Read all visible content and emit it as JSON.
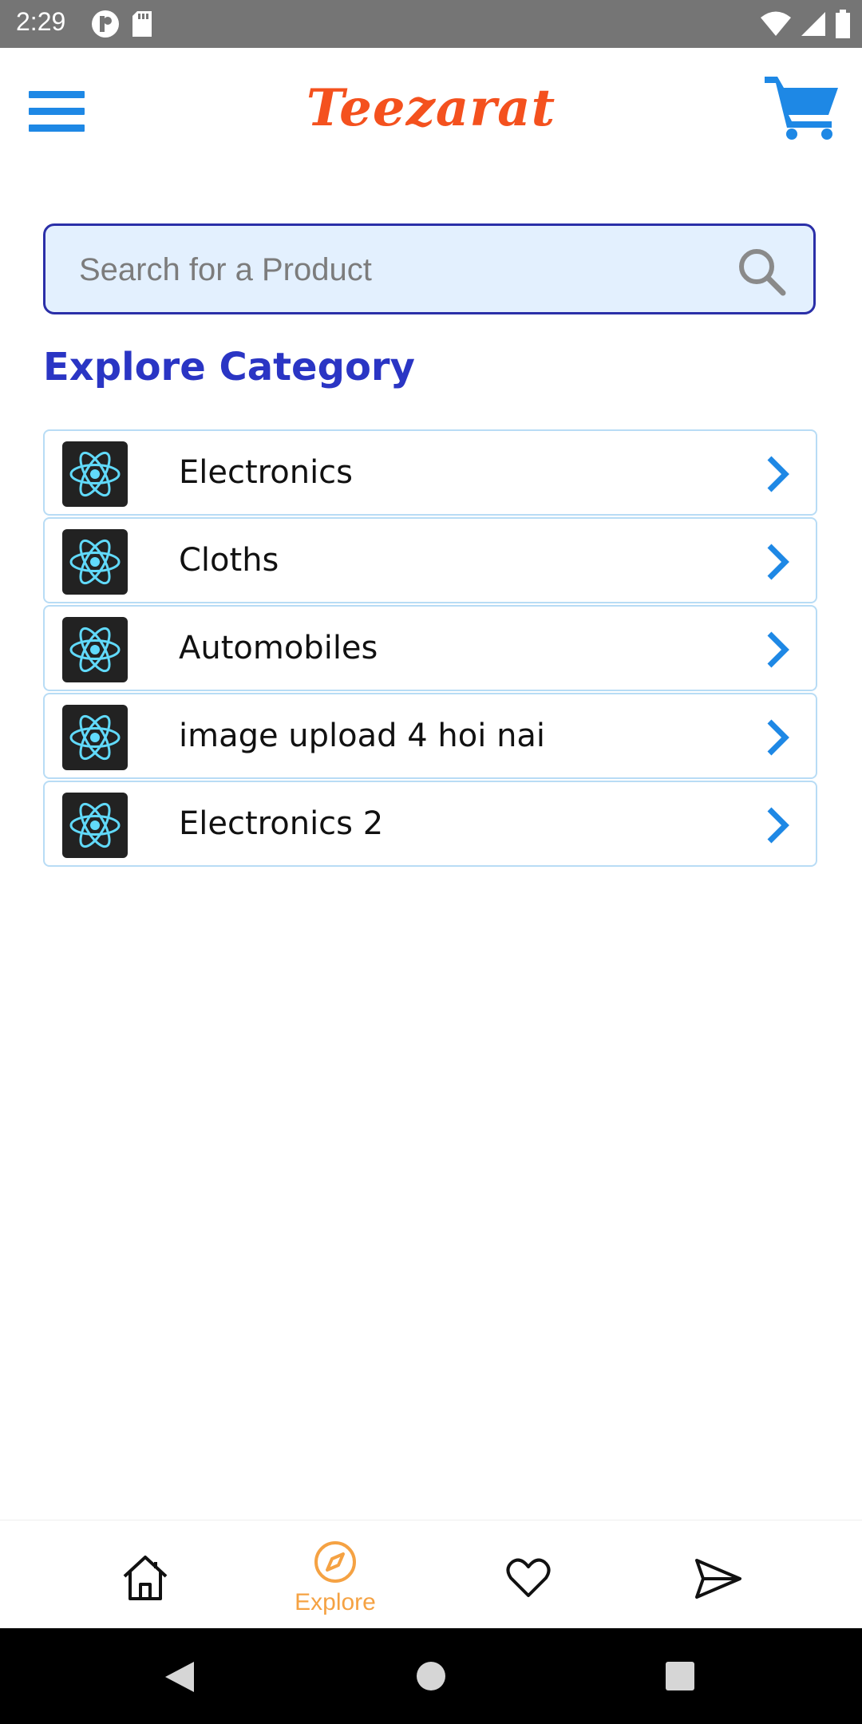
{
  "status_bar": {
    "time": "2:29",
    "icons": [
      "profile-notification-icon",
      "sd-card-icon",
      "wifi-icon",
      "signal-icon",
      "battery-icon"
    ]
  },
  "header": {
    "title": "Teezarat",
    "menu_icon": "hamburger-menu-icon",
    "cart_icon": "cart-icon",
    "title_color": "#f4511e",
    "accent_color": "#1e88e5"
  },
  "search": {
    "placeholder": "Search for a Product",
    "value": "",
    "icon": "search-icon"
  },
  "section": {
    "title": "Explore Category"
  },
  "categories": [
    {
      "label": "Electronics",
      "icon": "react-logo-icon"
    },
    {
      "label": "Cloths",
      "icon": "react-logo-icon"
    },
    {
      "label": "Automobiles",
      "icon": "react-logo-icon"
    },
    {
      "label": "image upload 4 hoi nai",
      "icon": "react-logo-icon"
    },
    {
      "label": "Electronics 2",
      "icon": "react-logo-icon"
    }
  ],
  "bottom_nav": {
    "items": [
      {
        "icon": "home-icon",
        "label": ""
      },
      {
        "icon": "compass-icon",
        "label": "Explore",
        "active": true
      },
      {
        "icon": "heart-icon",
        "label": ""
      },
      {
        "icon": "send-icon",
        "label": ""
      }
    ],
    "active_color": "#f5a243"
  },
  "system_nav": {
    "buttons": [
      "back-icon",
      "home-circle-icon",
      "recents-icon"
    ]
  }
}
